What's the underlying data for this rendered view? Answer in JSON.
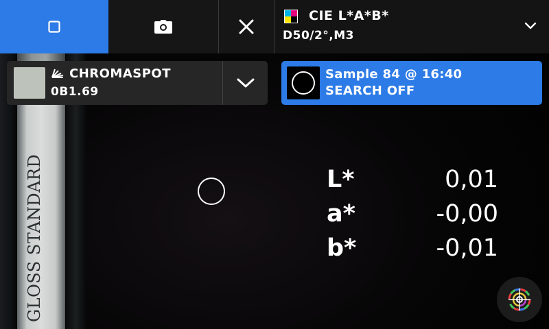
{
  "toolbar": {
    "measure_mode_icon": "square-icon",
    "camera_icon": "camera-icon",
    "close_icon": "close-icon",
    "active_color": "#2d7be6"
  },
  "measurement": {
    "color_space": "CIE L*A*B*",
    "conditions": "D50/2°,M3",
    "icon": "cmyk-swatch-icon"
  },
  "reference": {
    "brand": "CHROMASPOT",
    "code": "0B1.69",
    "swatch_color": "#bdc2ba"
  },
  "sample": {
    "title": "Sample 84 @ 16:40",
    "search_status": "SEARCH OFF"
  },
  "background": {
    "label_text": "GLOSS STANDARD"
  },
  "readings": [
    {
      "label": "L*",
      "value": "0,01"
    },
    {
      "label": "a*",
      "value": "-0,00"
    },
    {
      "label": "b*",
      "value": "-0,01"
    }
  ],
  "fab": {
    "icon": "color-target-icon"
  }
}
